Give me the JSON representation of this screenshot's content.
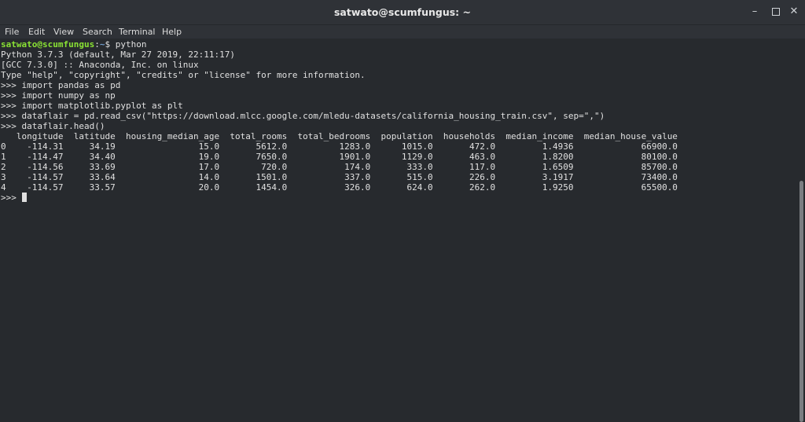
{
  "window": {
    "title": "satwato@scumfungus: ~"
  },
  "menu": [
    "File",
    "Edit",
    "View",
    "Search",
    "Terminal",
    "Help"
  ],
  "terminal": {
    "prompt": {
      "user_host": "satwato@scumfungus",
      "sep": ":",
      "path": "~",
      "dollar": "$ ",
      "command": "python"
    },
    "lines": [
      "Python 3.7.3 (default, Mar 27 2019, 22:11:17)",
      "[GCC 7.3.0] :: Anaconda, Inc. on linux",
      "Type \"help\", \"copyright\", \"credits\" or \"license\" for more information.",
      ">>> import pandas as pd",
      ">>> import numpy as np",
      ">>> import matplotlib.pyplot as plt",
      ">>> dataflair = pd.read_csv(\"https://download.mlcc.google.com/mledu-datasets/california_housing_train.csv\", sep=\",\")",
      ">>> dataflair.head()",
      "   longitude  latitude  housing_median_age  total_rooms  total_bedrooms  population  households  median_income  median_house_value",
      "0    -114.31     34.19                15.0       5612.0          1283.0      1015.0       472.0         1.4936             66900.0",
      "1    -114.47     34.40                19.0       7650.0          1901.0      1129.0       463.0         1.8200             80100.0",
      "2    -114.56     33.69                17.0        720.0           174.0       333.0       117.0         1.6509             85700.0",
      "3    -114.57     33.64                14.0       1501.0           337.0       515.0       226.0         3.1917             73400.0",
      "4    -114.57     33.57                20.0       1454.0           326.0       624.0       262.0         1.9250             65500.0"
    ],
    "input_prompt": ">>> "
  }
}
